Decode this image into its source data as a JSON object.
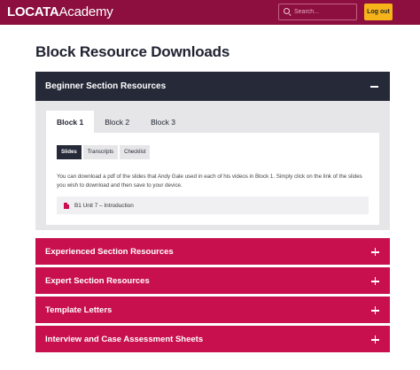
{
  "header": {
    "logo_bold": "LOCATA",
    "logo_light": "Academy",
    "search_placeholder": "Search...",
    "logout_label": "Log out",
    "brand_color": "#8c0f3f",
    "accent_color": "#f6b31a"
  },
  "page": {
    "title": "Block Resource Downloads"
  },
  "open_section": {
    "title": "Beginner Section Resources",
    "tabs": [
      {
        "label": "Block 1",
        "active": true
      },
      {
        "label": "Block 2",
        "active": false
      },
      {
        "label": "Block 3",
        "active": false
      }
    ],
    "subtabs": [
      {
        "label": "Slides",
        "active": true
      },
      {
        "label": "Transcripts",
        "active": false
      },
      {
        "label": "Checklist",
        "active": false
      }
    ],
    "description": "You can download a pdf of the slides that Andy Gale used in each of his videos in Block 1. Simply click on the link of the slides you wish to download and then save to your device.",
    "download_item": {
      "label": "B1 Unit 7 – Introduction",
      "icon": "pdf-file-icon"
    }
  },
  "sections": [
    {
      "title": "Experienced Section Resources"
    },
    {
      "title": "Expert Section Resources"
    },
    {
      "title": "Template Letters"
    },
    {
      "title": "Interview and Case Assessment Sheets"
    }
  ],
  "colors": {
    "dark_header": "#262a38",
    "section_red": "#c8104e"
  }
}
